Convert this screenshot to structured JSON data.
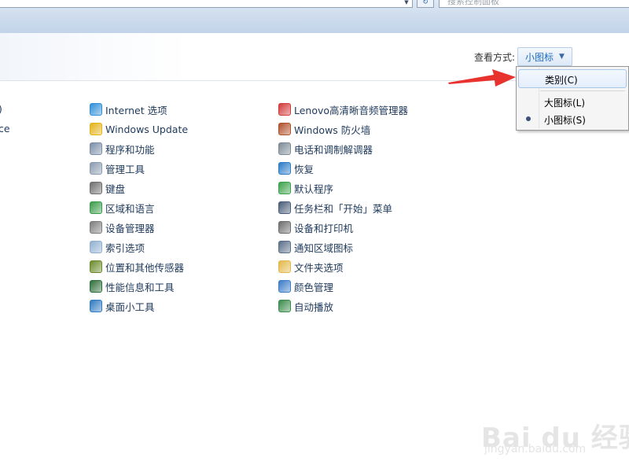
{
  "search": {
    "placeholder": "搜索控制面板",
    "address_dropdown_icon": "chevron-down-icon",
    "refresh_icon": "refresh-icon"
  },
  "view": {
    "label": "查看方式:",
    "current": "小图标"
  },
  "menu": {
    "items": [
      {
        "label": "类别(C)",
        "state": "hover"
      },
      {
        "label": "大图标(L)",
        "state": "normal"
      },
      {
        "label": "小图标(S)",
        "state": "selected"
      }
    ]
  },
  "edge_items": [
    ")",
    "ce"
  ],
  "column2": [
    {
      "label": "Internet 选项",
      "icon": "globe-icon",
      "color": "#2f8fd8"
    },
    {
      "label": "Windows Update",
      "icon": "windows-update-icon",
      "color": "#e3b317"
    },
    {
      "label": "程序和功能",
      "icon": "programs-icon",
      "color": "#7a8ea8"
    },
    {
      "label": "管理工具",
      "icon": "admin-tools-icon",
      "color": "#8a9bb0"
    },
    {
      "label": "键盘",
      "icon": "keyboard-icon",
      "color": "#6e6e6e"
    },
    {
      "label": "区域和语言",
      "icon": "region-globe-icon",
      "color": "#3a9b4a"
    },
    {
      "label": "设备管理器",
      "icon": "device-manager-icon",
      "color": "#7d7d7d"
    },
    {
      "label": "索引选项",
      "icon": "search-index-icon",
      "color": "#8fb0d0"
    },
    {
      "label": "位置和其他传感器",
      "icon": "sensor-icon",
      "color": "#6a8a2a"
    },
    {
      "label": "性能信息和工具",
      "icon": "performance-icon",
      "color": "#2e6e3a"
    },
    {
      "label": "桌面小工具",
      "icon": "gadgets-icon",
      "color": "#2f7ac0"
    }
  ],
  "column3": [
    {
      "label": "Lenovo高清晰音频管理器",
      "icon": "lenovo-audio-icon",
      "color": "#d23a3a"
    },
    {
      "label": "Windows 防火墙",
      "icon": "firewall-icon",
      "color": "#b0502a"
    },
    {
      "label": "电话和调制解调器",
      "icon": "phone-modem-icon",
      "color": "#7c8a96"
    },
    {
      "label": "恢复",
      "icon": "recovery-icon",
      "color": "#2a7ac8"
    },
    {
      "label": "默认程序",
      "icon": "default-programs-icon",
      "color": "#3aa14a"
    },
    {
      "label": "任务栏和「开始」菜单",
      "icon": "taskbar-icon",
      "color": "#4a5c78"
    },
    {
      "label": "设备和打印机",
      "icon": "printer-icon",
      "color": "#6d6d6d"
    },
    {
      "label": "通知区域图标",
      "icon": "notification-icon",
      "color": "#5a6e88"
    },
    {
      "label": "文件夹选项",
      "icon": "folder-options-icon",
      "color": "#e2b84a"
    },
    {
      "label": "颜色管理",
      "icon": "color-management-icon",
      "color": "#3b7bc8"
    },
    {
      "label": "自动播放",
      "icon": "autoplay-icon",
      "color": "#3a8a4a"
    }
  ],
  "watermark": {
    "brand": "Bai du 经验",
    "url": "jingyan.baidu.com"
  },
  "annotation_color": "#e8322e"
}
